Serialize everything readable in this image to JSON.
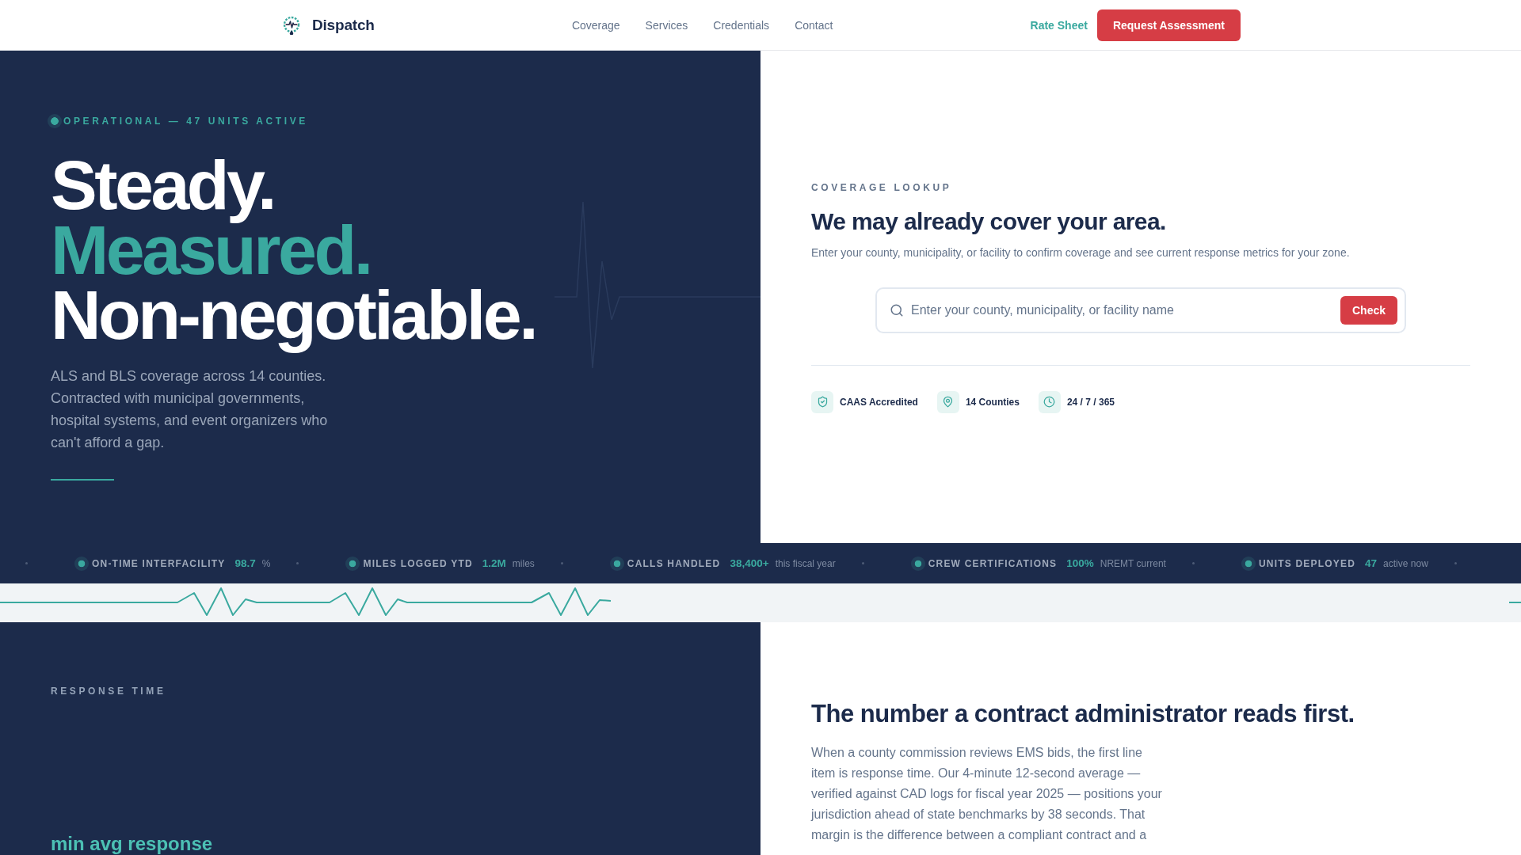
{
  "nav": {
    "brand": "Dispatch",
    "links": [
      {
        "label": "Coverage"
      },
      {
        "label": "Services"
      },
      {
        "label": "Credentials"
      },
      {
        "label": "Contact"
      }
    ],
    "rate_sheet": "Rate Sheet",
    "cta": "Request Assessment"
  },
  "hero": {
    "status": "OPERATIONAL — 47 UNITS ACTIVE",
    "headline": [
      {
        "text": "Steady.",
        "accent": false
      },
      {
        "text": "Measured.",
        "accent": true
      },
      {
        "text": "Non-negotiable.",
        "accent": false
      }
    ],
    "body": "ALS and BLS coverage across 14 counties. Contracted with municipal governments, hospital systems, and event organizers who can't afford a gap."
  },
  "coverage": {
    "eyebrow": "COVERAGE LOOKUP",
    "title": "We may already cover your area.",
    "description": "Enter your county, municipality, or facility to confirm coverage and see current response metrics for your zone.",
    "search": {
      "placeholder": "Enter your county, municipality, or facility name",
      "button": "Check"
    },
    "badges": [
      {
        "kind": "shield",
        "label": "CAAS Accredited"
      },
      {
        "kind": "pin",
        "label": "14 Counties"
      },
      {
        "kind": "clock",
        "label": "24 / 7 / 365"
      }
    ]
  },
  "ticker": [
    {
      "label": "ON-TIME INTERFACILITY",
      "value": "98.7",
      "unit": "%"
    },
    {
      "label": "MILES LOGGED YTD",
      "value": "1.2M",
      "unit": "miles"
    },
    {
      "label": "CALLS HANDLED",
      "value": "38,400+",
      "unit": "this fiscal year"
    },
    {
      "label": "CREW CERTIFICATIONS",
      "value": "100%",
      "unit": "NREMT current"
    },
    {
      "label": "UNITS DEPLOYED",
      "value": "47",
      "unit": "active now"
    }
  ],
  "response": {
    "eyebrow": "RESPONSE TIME",
    "caption": "min avg response"
  },
  "article": {
    "title": "The number a contract administrator reads first.",
    "body": "When a county commission reviews EMS bids, the first line item is response time. Our 4-minute 12-second average — verified against CAD logs for fiscal year 2025 — positions your jurisdiction ahead of state benchmarks by 38 seconds. That margin is the difference between a compliant contract and a"
  }
}
